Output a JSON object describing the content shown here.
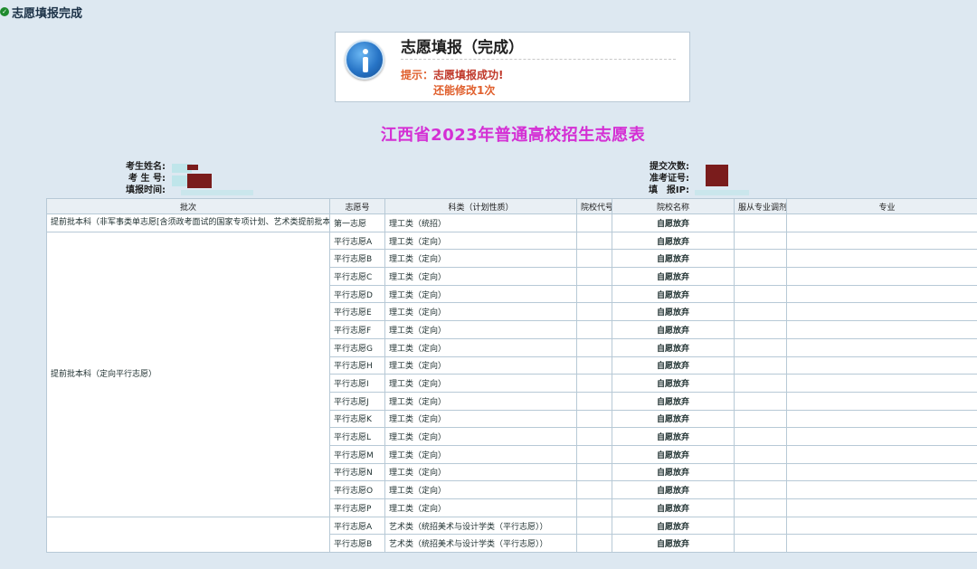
{
  "status_bar": {
    "icon": "check-icon",
    "title": "志愿填报完成"
  },
  "notice": {
    "icon": "info-icon",
    "title": "志愿填报（完成）",
    "hint_label": "提示：",
    "message_line1": "志愿填报成功!",
    "message_line2": "还能修改1次"
  },
  "page_title": "江西省2023年普通高校招生志愿表",
  "student_info": {
    "name_label": "考生姓名:",
    "exam_id_label": "考 生 号:",
    "fill_time_label": "填报时间:",
    "submit_count_label": "提交次数:",
    "admission_no_label": "准考证号:",
    "fill_ip_label": "填　报IP:"
  },
  "table": {
    "headers": {
      "batch": "批次",
      "volunteer_no": "志愿号",
      "subject": "科类（计划性质）",
      "school_code": "院校代号",
      "school_name": "院校名称",
      "accept_adjust": "服从专业调剂",
      "major": "专业"
    },
    "batch_groups": [
      "提前批本科（非军事类单志愿[含须政考面试的国家专项计划、艺术类提前批本科单志愿]）",
      "提前批本科（定向平行志愿）",
      ""
    ],
    "rows": [
      {
        "volunteer": "第一志愿",
        "subject": "理工类（统招）",
        "school_name": "自愿放弃"
      },
      {
        "volunteer": "平行志愿A",
        "subject": "理工类（定向）",
        "school_name": "自愿放弃"
      },
      {
        "volunteer": "平行志愿B",
        "subject": "理工类（定向）",
        "school_name": "自愿放弃"
      },
      {
        "volunteer": "平行志愿C",
        "subject": "理工类（定向）",
        "school_name": "自愿放弃"
      },
      {
        "volunteer": "平行志愿D",
        "subject": "理工类（定向）",
        "school_name": "自愿放弃"
      },
      {
        "volunteer": "平行志愿E",
        "subject": "理工类（定向）",
        "school_name": "自愿放弃"
      },
      {
        "volunteer": "平行志愿F",
        "subject": "理工类（定向）",
        "school_name": "自愿放弃"
      },
      {
        "volunteer": "平行志愿G",
        "subject": "理工类（定向）",
        "school_name": "自愿放弃"
      },
      {
        "volunteer": "平行志愿H",
        "subject": "理工类（定向）",
        "school_name": "自愿放弃"
      },
      {
        "volunteer": "平行志愿I",
        "subject": "理工类（定向）",
        "school_name": "自愿放弃"
      },
      {
        "volunteer": "平行志愿J",
        "subject": "理工类（定向）",
        "school_name": "自愿放弃"
      },
      {
        "volunteer": "平行志愿K",
        "subject": "理工类（定向）",
        "school_name": "自愿放弃"
      },
      {
        "volunteer": "平行志愿L",
        "subject": "理工类（定向）",
        "school_name": "自愿放弃"
      },
      {
        "volunteer": "平行志愿M",
        "subject": "理工类（定向）",
        "school_name": "自愿放弃"
      },
      {
        "volunteer": "平行志愿N",
        "subject": "理工类（定向）",
        "school_name": "自愿放弃"
      },
      {
        "volunteer": "平行志愿O",
        "subject": "理工类（定向）",
        "school_name": "自愿放弃"
      },
      {
        "volunteer": "平行志愿P",
        "subject": "理工类（定向）",
        "school_name": "自愿放弃"
      },
      {
        "volunteer": "平行志愿A",
        "subject": "艺术类（统招美术与设计学类（平行志愿））",
        "school_name": "自愿放弃"
      },
      {
        "volunteer": "平行志愿B",
        "subject": "艺术类（统招美术与设计学类（平行志愿））",
        "school_name": "自愿放弃"
      }
    ]
  }
}
